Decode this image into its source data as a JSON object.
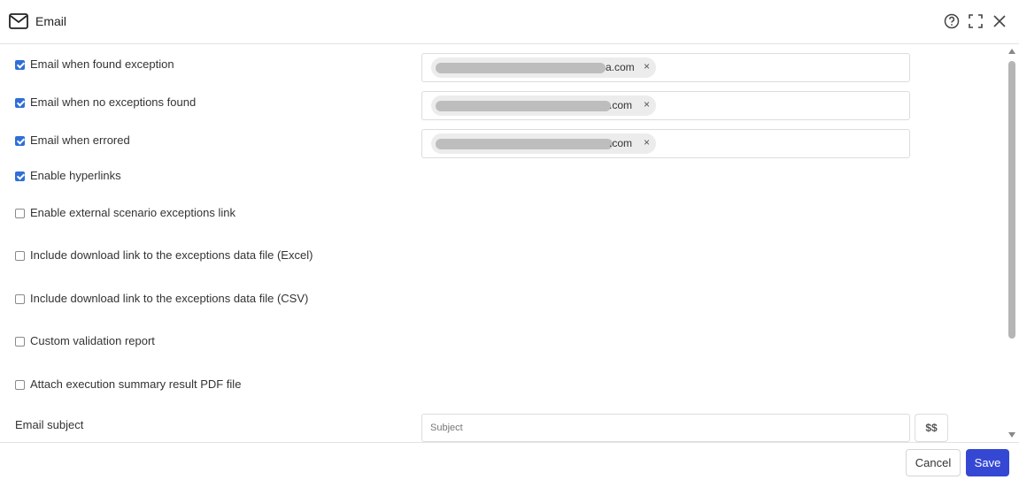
{
  "dialog": {
    "title": "Email",
    "icons": [
      "mail-icon",
      "help-icon",
      "fullscreen-icon",
      "close-icon"
    ]
  },
  "options": [
    {
      "label": "Email when found exception",
      "checked": true
    },
    {
      "label": "Email when no exceptions found",
      "checked": true
    },
    {
      "label": "Email when errored",
      "checked": true
    },
    {
      "label": "Enable hyperlinks",
      "checked": true
    },
    {
      "label": "Enable external scenario exceptions link",
      "checked": false
    },
    {
      "label": "Include download link to the exceptions data file (Excel)",
      "checked": false
    },
    {
      "label": "Include download link to the exceptions data file (CSV)",
      "checked": false
    },
    {
      "label": "Custom validation report",
      "checked": false
    },
    {
      "label": "Attach execution summary result PDF file",
      "checked": false
    }
  ],
  "recipients": [
    {
      "visible_text": "a.com",
      "remove": "×"
    },
    {
      "visible_text": ".com",
      "remove": "×"
    },
    {
      "visible_text": ".com",
      "remove": "×"
    }
  ],
  "subject": {
    "label": "Email subject",
    "placeholder": "Subject",
    "variable_button": "$$"
  },
  "footer": {
    "cancel_label": "Cancel",
    "save_label": "Save"
  },
  "colors": {
    "accent": "#3548d4",
    "checkbox": "#2f6fd6"
  }
}
